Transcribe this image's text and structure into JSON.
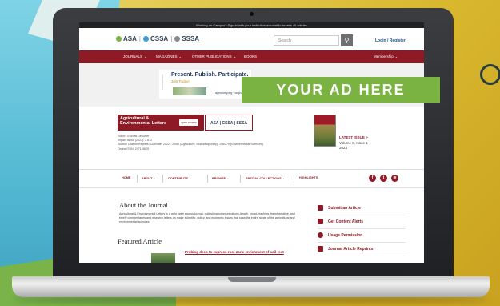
{
  "notice": "Working on Campus? Sign in with your institution account to access all articles",
  "header": {
    "logos": [
      "ASA",
      "CSSA",
      "SSSA"
    ],
    "search_placeholder": "Search",
    "search_icon": "magnifier-icon",
    "login_label": "Login / Register"
  },
  "nav": {
    "items": [
      "JOURNALS",
      "MAGAZINES",
      "OTHER PUBLICATIONS",
      "BOOKS"
    ],
    "membership": "Membership"
  },
  "ad": {
    "headline": "Present. Publish. Participate.",
    "join": "Join Today!",
    "url": "agronomy.org · crops.org",
    "vertical_label": "Advertisement",
    "box_text": "YOUR AD HERE"
  },
  "journal": {
    "title_line1": "Agricultural &",
    "title_line2": "Environmental Letters",
    "oa_badge": "open access",
    "logos_text": "ASA | CSSA | SSSA",
    "editor": "Editor: Thomas DeSutter",
    "impact": "Impact factor (2021): 2.612",
    "citation": "Journal Citation Reports (Clarivate, 2022): 20/60 (Agriculture, Multidisciplinary); 198/279 (Environmental Sciences)",
    "issn": "Online ISSN: 2471-9625",
    "latest_label": "LATEST ISSUE >",
    "latest_volume": "Volume 8, Issue 1",
    "latest_year": "2023"
  },
  "subnav": {
    "items": [
      "HOME",
      "ABOUT",
      "CONTRIBUTE",
      "BROWSE",
      "SPECIAL COLLECTIONS",
      "HIGHLIGHTS"
    ]
  },
  "about": {
    "heading": "About the Journal",
    "text": "Agricultural & Environmental Letters is a gold open access journal, publishing communications-length, broad-reaching, transformative, and timely commentaries and research letters on major scientific, policy, and economic issues that span the entire range of the agricultural and environmental sciences."
  },
  "featured": {
    "heading": "Featured Article",
    "title": "Probing deep to express root-zone enrichment of soil-test"
  },
  "sidebar": {
    "items": [
      "Submit an Article",
      "Get Content Alerts",
      "Usage Permission",
      "Journal Article Reprints"
    ]
  },
  "colors": {
    "brand": "#8d1a24",
    "ad_green": "#7ab342"
  }
}
